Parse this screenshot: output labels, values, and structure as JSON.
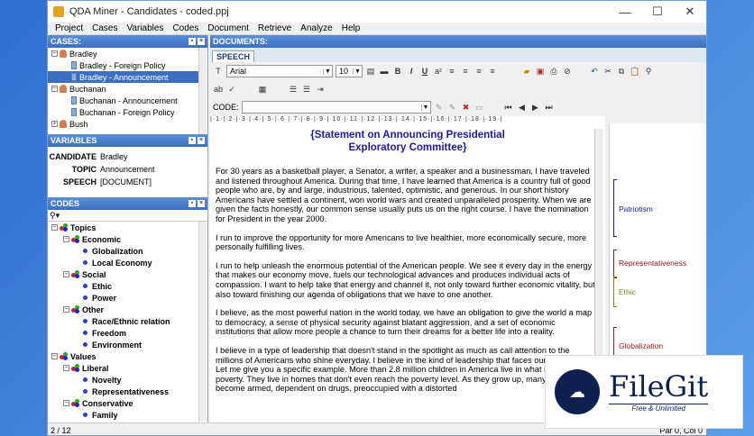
{
  "window": {
    "title": "QDA Miner - Candidates - coded.ppj",
    "minimize": "—",
    "maximize": "☐",
    "close": "✕"
  },
  "menu": [
    "Project",
    "Cases",
    "Variables",
    "Codes",
    "Document",
    "Retrieve",
    "Analyze",
    "Help"
  ],
  "cases_panel": {
    "header": "CASES:",
    "rows": [
      {
        "label": "Bradley",
        "type": "person",
        "indent": 0,
        "expander": "−"
      },
      {
        "label": "Bradley - Foreign Policy",
        "type": "doc",
        "indent": 1
      },
      {
        "label": "Bradley - Announcement",
        "type": "doc",
        "indent": 1,
        "selected": true
      },
      {
        "label": "Buchanan",
        "type": "person",
        "indent": 0,
        "expander": "−"
      },
      {
        "label": "Buchanan - Announcement",
        "type": "doc",
        "indent": 1
      },
      {
        "label": "Buchanan - Foreign Policy",
        "type": "doc",
        "indent": 1
      },
      {
        "label": "Bush",
        "type": "person",
        "indent": 0,
        "expander": "+"
      }
    ]
  },
  "variables_panel": {
    "header": "VARIABLES",
    "rows": [
      {
        "name": "CANDIDATE",
        "value": "Bradley"
      },
      {
        "name": "TOPIC",
        "value": "Announcement"
      },
      {
        "name": "SPEECH",
        "value": "[DOCUMENT]"
      }
    ]
  },
  "codes_panel": {
    "header": "CODES",
    "rows": [
      {
        "label": "Topics",
        "type": "category",
        "indent": 0,
        "expander": "−"
      },
      {
        "label": "Economic",
        "type": "category",
        "indent": 1,
        "expander": "−"
      },
      {
        "label": "Globalization",
        "type": "code",
        "indent": 2
      },
      {
        "label": "Local Economy",
        "type": "code",
        "indent": 2
      },
      {
        "label": "Social",
        "type": "category",
        "indent": 1,
        "expander": "−"
      },
      {
        "label": "Ethic",
        "type": "code",
        "indent": 2
      },
      {
        "label": "Power",
        "type": "code",
        "indent": 2
      },
      {
        "label": "Other",
        "type": "category",
        "indent": 1,
        "expander": "−"
      },
      {
        "label": "Race/Ethnic relation",
        "type": "code",
        "indent": 2
      },
      {
        "label": "Freedom",
        "type": "code",
        "indent": 2
      },
      {
        "label": "Environment",
        "type": "code",
        "indent": 2
      },
      {
        "label": "Values",
        "type": "category",
        "indent": 0,
        "expander": "−"
      },
      {
        "label": "Liberal",
        "type": "category",
        "indent": 1,
        "expander": "−"
      },
      {
        "label": "Novelty",
        "type": "code",
        "indent": 2
      },
      {
        "label": "Representativeness",
        "type": "code",
        "indent": 2
      },
      {
        "label": "Conservative",
        "type": "category",
        "indent": 1,
        "expander": "−"
      },
      {
        "label": "Family",
        "type": "code",
        "indent": 2
      }
    ]
  },
  "documents": {
    "header": "DOCUMENTS:",
    "tab": "SPEECH",
    "font": "Arial",
    "font_size": "10",
    "code_label": "CODE:",
    "doc_title_line1": "{Statement on Announcing Presidential",
    "doc_title_line2": "Exploratory Committee}",
    "paragraphs": [
      "For 30 years as a basketball player, a Senator, a writer, a speaker and a businessman, I have traveled and listened throughout America. During that time, I have learned that America is a country full of good people who are, by and large, industrious, talented, optimistic, and generous. In our short history Americans have settled a continent, won world wars and created unparalleled prosperity. When we are given the facts honestly, our common sense usually puts us on the right course. I have the nomination for President in the year 2000.",
      "I run to improve the opportunity for more Americans to live healthier, more economically secure, more personally fulfilling lives.",
      "I run to help unleash the enormous potential of the American people. We see it every day in the energy that makes our economy move, fuels our technological advances and produces individual acts of compassion. I want to help take that energy and channel it, not only toward further economic vitality, but also toward finishing our agenda of obligations that we have to one another.",
      "I believe, as the most powerful nation in the world today, we have an obligation to give the world a map to democracy, a sense of physical security against blatant aggression, and a set of economic institutions that allow more people a chance to turn their dreams for a better life into a reality.",
      "I believe in a type of leadership that doesn't stand in the spotlight as much as call attention to the millions of Americans who shine everyday. I believe in the kind of leadership that faces our problems. Let me give you a specific example. More than 2.8 million children in America live in what is called deep poverty. They live in homes that don't even reach the poverty level. As they grow up, many of them become armed, dependent on drugs, preoccupied with a distorted"
    ]
  },
  "margin_codes": [
    {
      "label": "Patriotism",
      "color": "#1a1aa8"
    },
    {
      "label": "Representativeness",
      "color": "#a01818"
    },
    {
      "label": "Ethic",
      "color": "#7a8a10"
    },
    {
      "label": "Globalization",
      "color": "#b01818"
    }
  ],
  "status": {
    "left": "2 / 12",
    "right": "Par 0, Col 0"
  },
  "watermark": {
    "name": "FileGit",
    "tagline": "Free & Unlimited"
  }
}
